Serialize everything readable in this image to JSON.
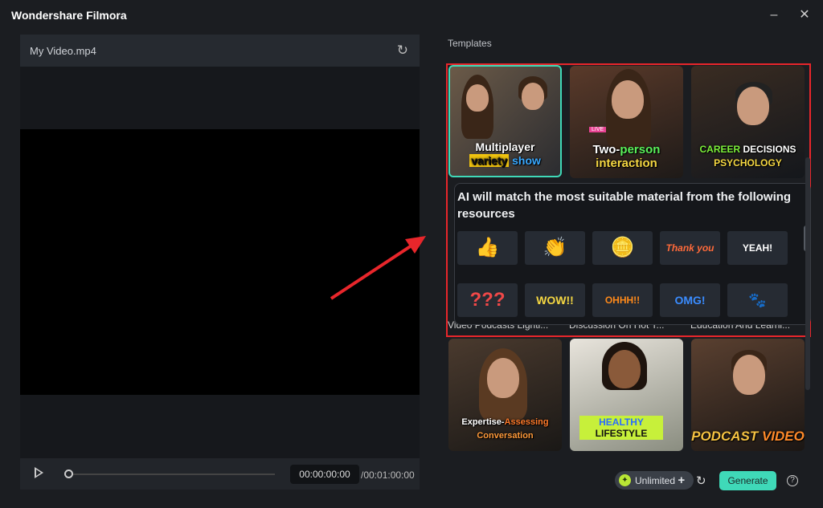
{
  "app": {
    "title": "Wondershare Filmora",
    "minimize_icon": "minimize-icon",
    "close_icon": "close-icon"
  },
  "player": {
    "file_name": "My Video.mp4",
    "current_time": "00:00:00:00",
    "duration": "/00:01:00:00",
    "progress": 0
  },
  "templates": {
    "label": "Templates",
    "row1": [
      {
        "caption_line1": "Multiplayer",
        "caption_line2a": "variety",
        "caption_line2b": "show",
        "title": "Vi..."
      },
      {
        "caption_line1a": "Two-",
        "caption_line1b": "person",
        "caption_line2": "interaction",
        "badge": "LIVE"
      },
      {
        "caption_line1a": "CAREER",
        "caption_line1b": "DECISIONS",
        "caption_line2": "PSYCHOLOGY"
      }
    ],
    "row1_titles": [
      "Video Podcasts Lighti...",
      "Discussion On Hot T...",
      "Education And Learni..."
    ],
    "row2": [
      {
        "caption_line1a": "Expertise-",
        "caption_line1b": "Assessing",
        "caption_line2": "Conversation"
      },
      {
        "caption_line1": "HEALTHY",
        "caption_line2": "LIFESTYLE"
      },
      {
        "caption_line1a": "PODCAST",
        "caption_line1b": "VIDEO"
      }
    ]
  },
  "popup": {
    "text": "AI will match the most suitable material from the following resources",
    "resources": [
      {
        "glyph": "👍",
        "name": "thumbs-up-sticker"
      },
      {
        "glyph": "👏",
        "name": "clap-sticker"
      },
      {
        "glyph": "🪙",
        "name": "flying-coin-sticker"
      },
      {
        "glyph": "Thank you",
        "name": "thank-you-sticker"
      },
      {
        "glyph": "YEAH!",
        "name": "yeah-sticker"
      },
      {
        "glyph": "???",
        "name": "question-marks-sticker"
      },
      {
        "glyph": "WOW!!",
        "name": "wow-sticker"
      },
      {
        "glyph": "OHHH!!",
        "name": "ohhh-sticker"
      },
      {
        "glyph": "OMG!",
        "name": "omg-sticker"
      },
      {
        "glyph": "🐾",
        "name": "paw-prints-sticker"
      }
    ]
  },
  "footer": {
    "credits_label": "Unlimited",
    "credits_plus": "+",
    "generate_label": "Generate",
    "help": "?"
  },
  "colors": {
    "accent": "#3fd9b8",
    "highlight_box": "#e8262b",
    "arrow": "#e8262b",
    "credit_icon": "#b9e635"
  }
}
